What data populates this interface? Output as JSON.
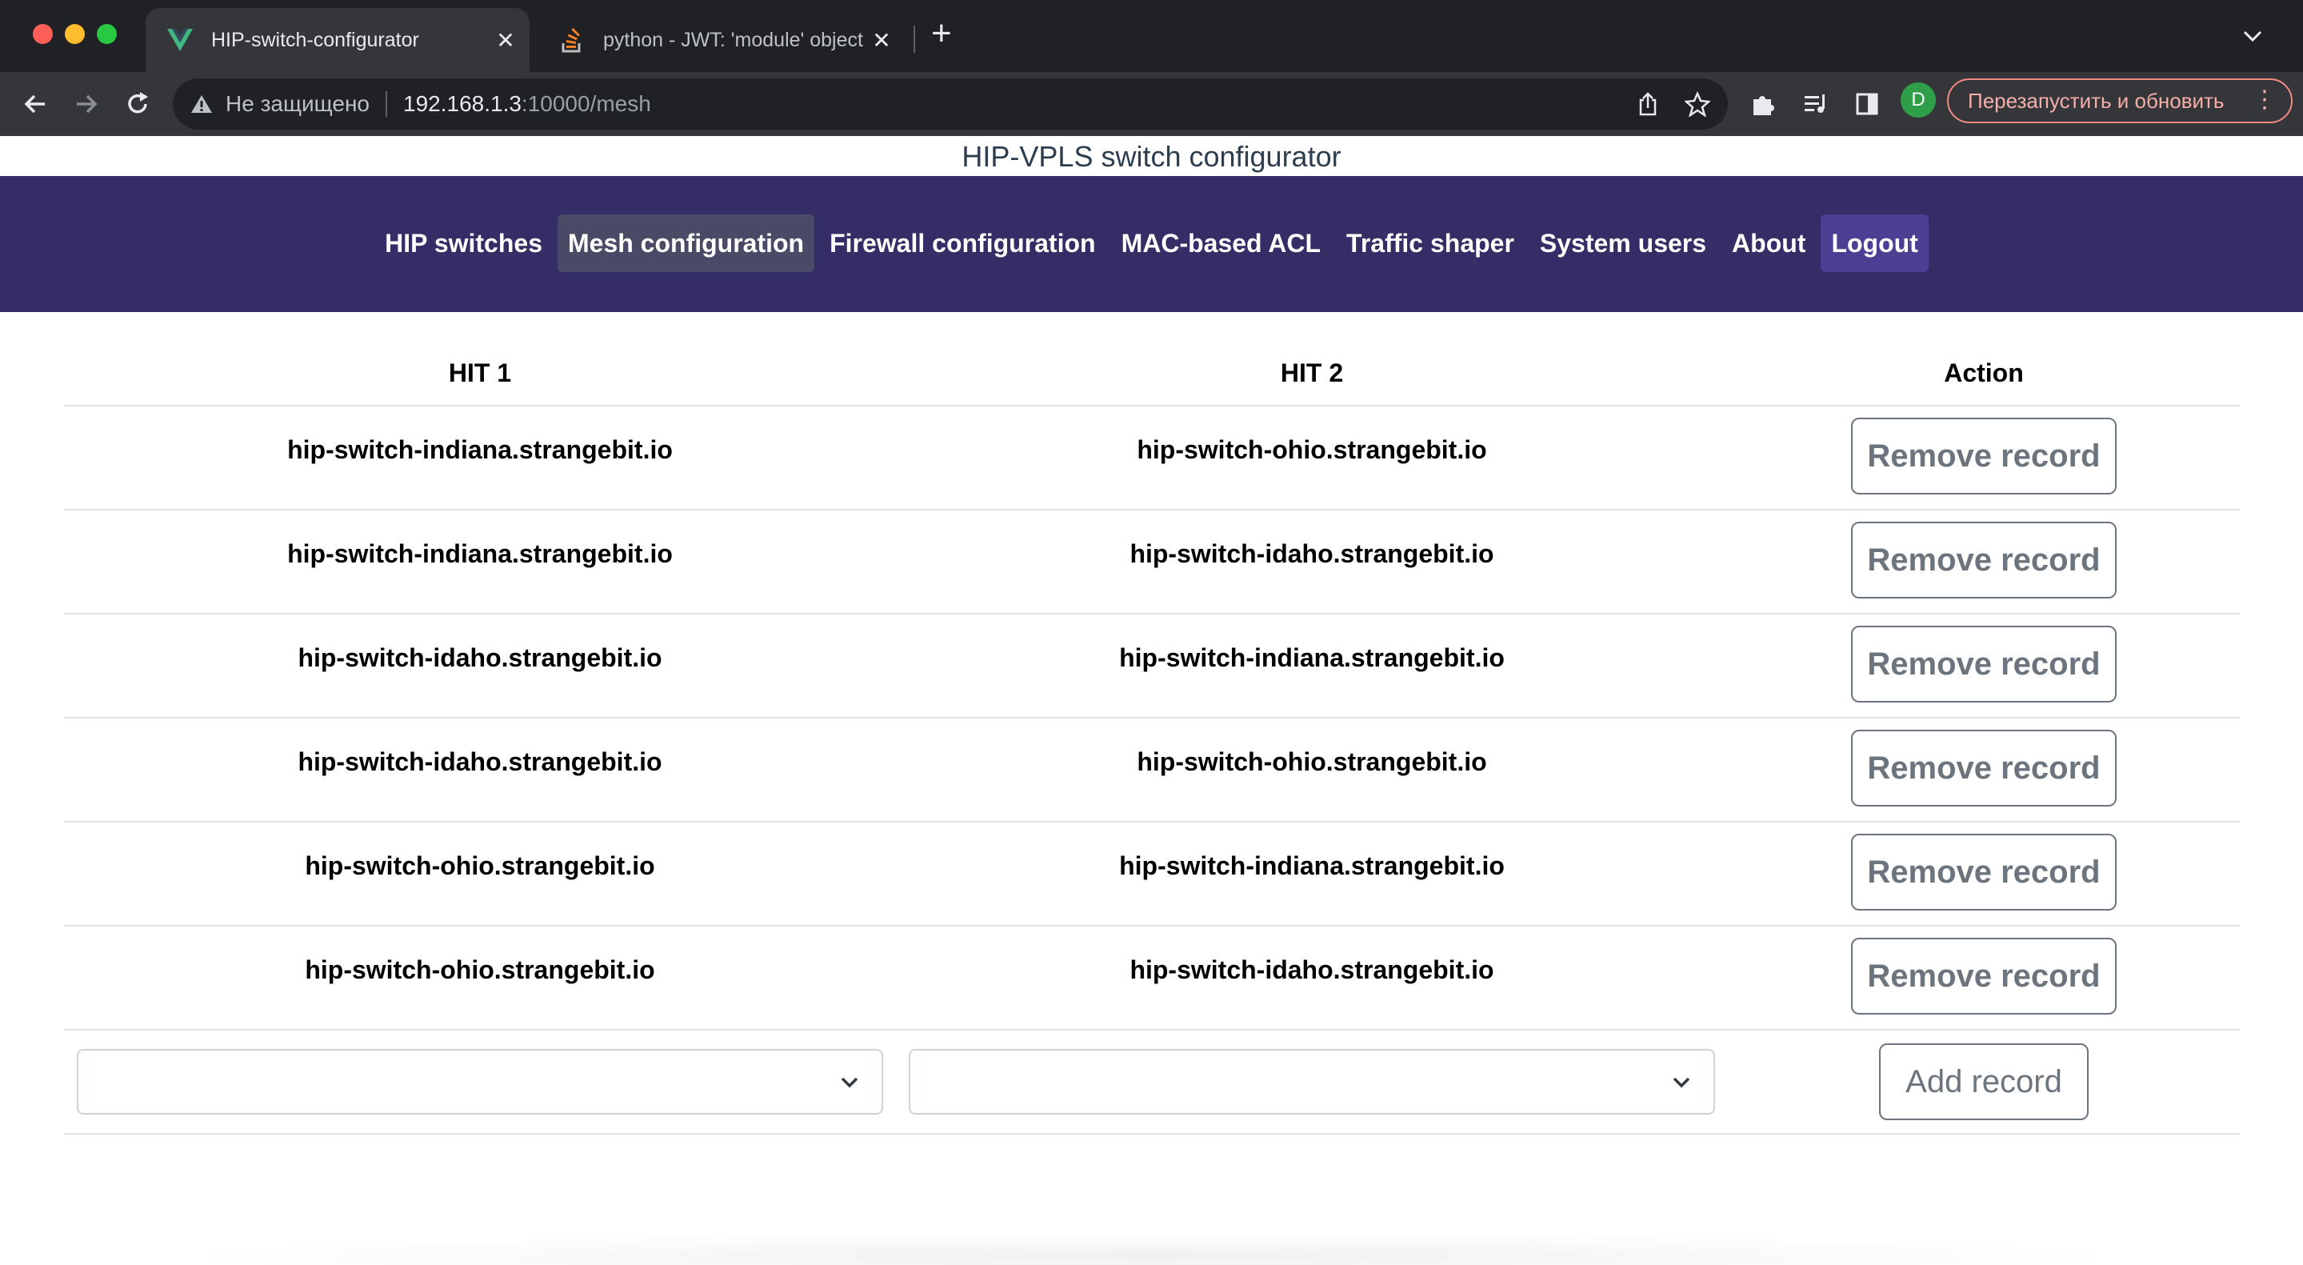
{
  "browser": {
    "active_tab_title": "HIP-switch-configurator",
    "inactive_tab_title": "python - JWT: 'module' object",
    "tab_close": "✕",
    "new_tab": "+",
    "security_label": "Не защищено",
    "url_host": "192.168.1.3",
    "url_path": ":10000/mesh",
    "profile_initial": "D",
    "relaunch_label": "Перезапустить и обновить"
  },
  "page": {
    "title": "HIP-VPLS switch configurator"
  },
  "nav": {
    "items": [
      {
        "label": "HIP switches"
      },
      {
        "label": "Mesh configuration"
      },
      {
        "label": "Firewall configuration"
      },
      {
        "label": "MAC-based ACL"
      },
      {
        "label": "Traffic shaper"
      },
      {
        "label": "System users"
      },
      {
        "label": "About"
      },
      {
        "label": "Logout"
      }
    ]
  },
  "table": {
    "headers": {
      "hit1": "HIT 1",
      "hit2": "HIT 2",
      "action": "Action"
    },
    "rows": [
      {
        "hit1": "hip-switch-indiana.strangebit.io",
        "hit2": "hip-switch-ohio.strangebit.io"
      },
      {
        "hit1": "hip-switch-indiana.strangebit.io",
        "hit2": "hip-switch-idaho.strangebit.io"
      },
      {
        "hit1": "hip-switch-idaho.strangebit.io",
        "hit2": "hip-switch-indiana.strangebit.io"
      },
      {
        "hit1": "hip-switch-idaho.strangebit.io",
        "hit2": "hip-switch-ohio.strangebit.io"
      },
      {
        "hit1": "hip-switch-ohio.strangebit.io",
        "hit2": "hip-switch-indiana.strangebit.io"
      },
      {
        "hit1": "hip-switch-ohio.strangebit.io",
        "hit2": "hip-switch-idaho.strangebit.io"
      }
    ],
    "remove_label": "Remove record",
    "add_label": "Add record",
    "hit1_select_value": "",
    "hit2_select_value": ""
  }
}
